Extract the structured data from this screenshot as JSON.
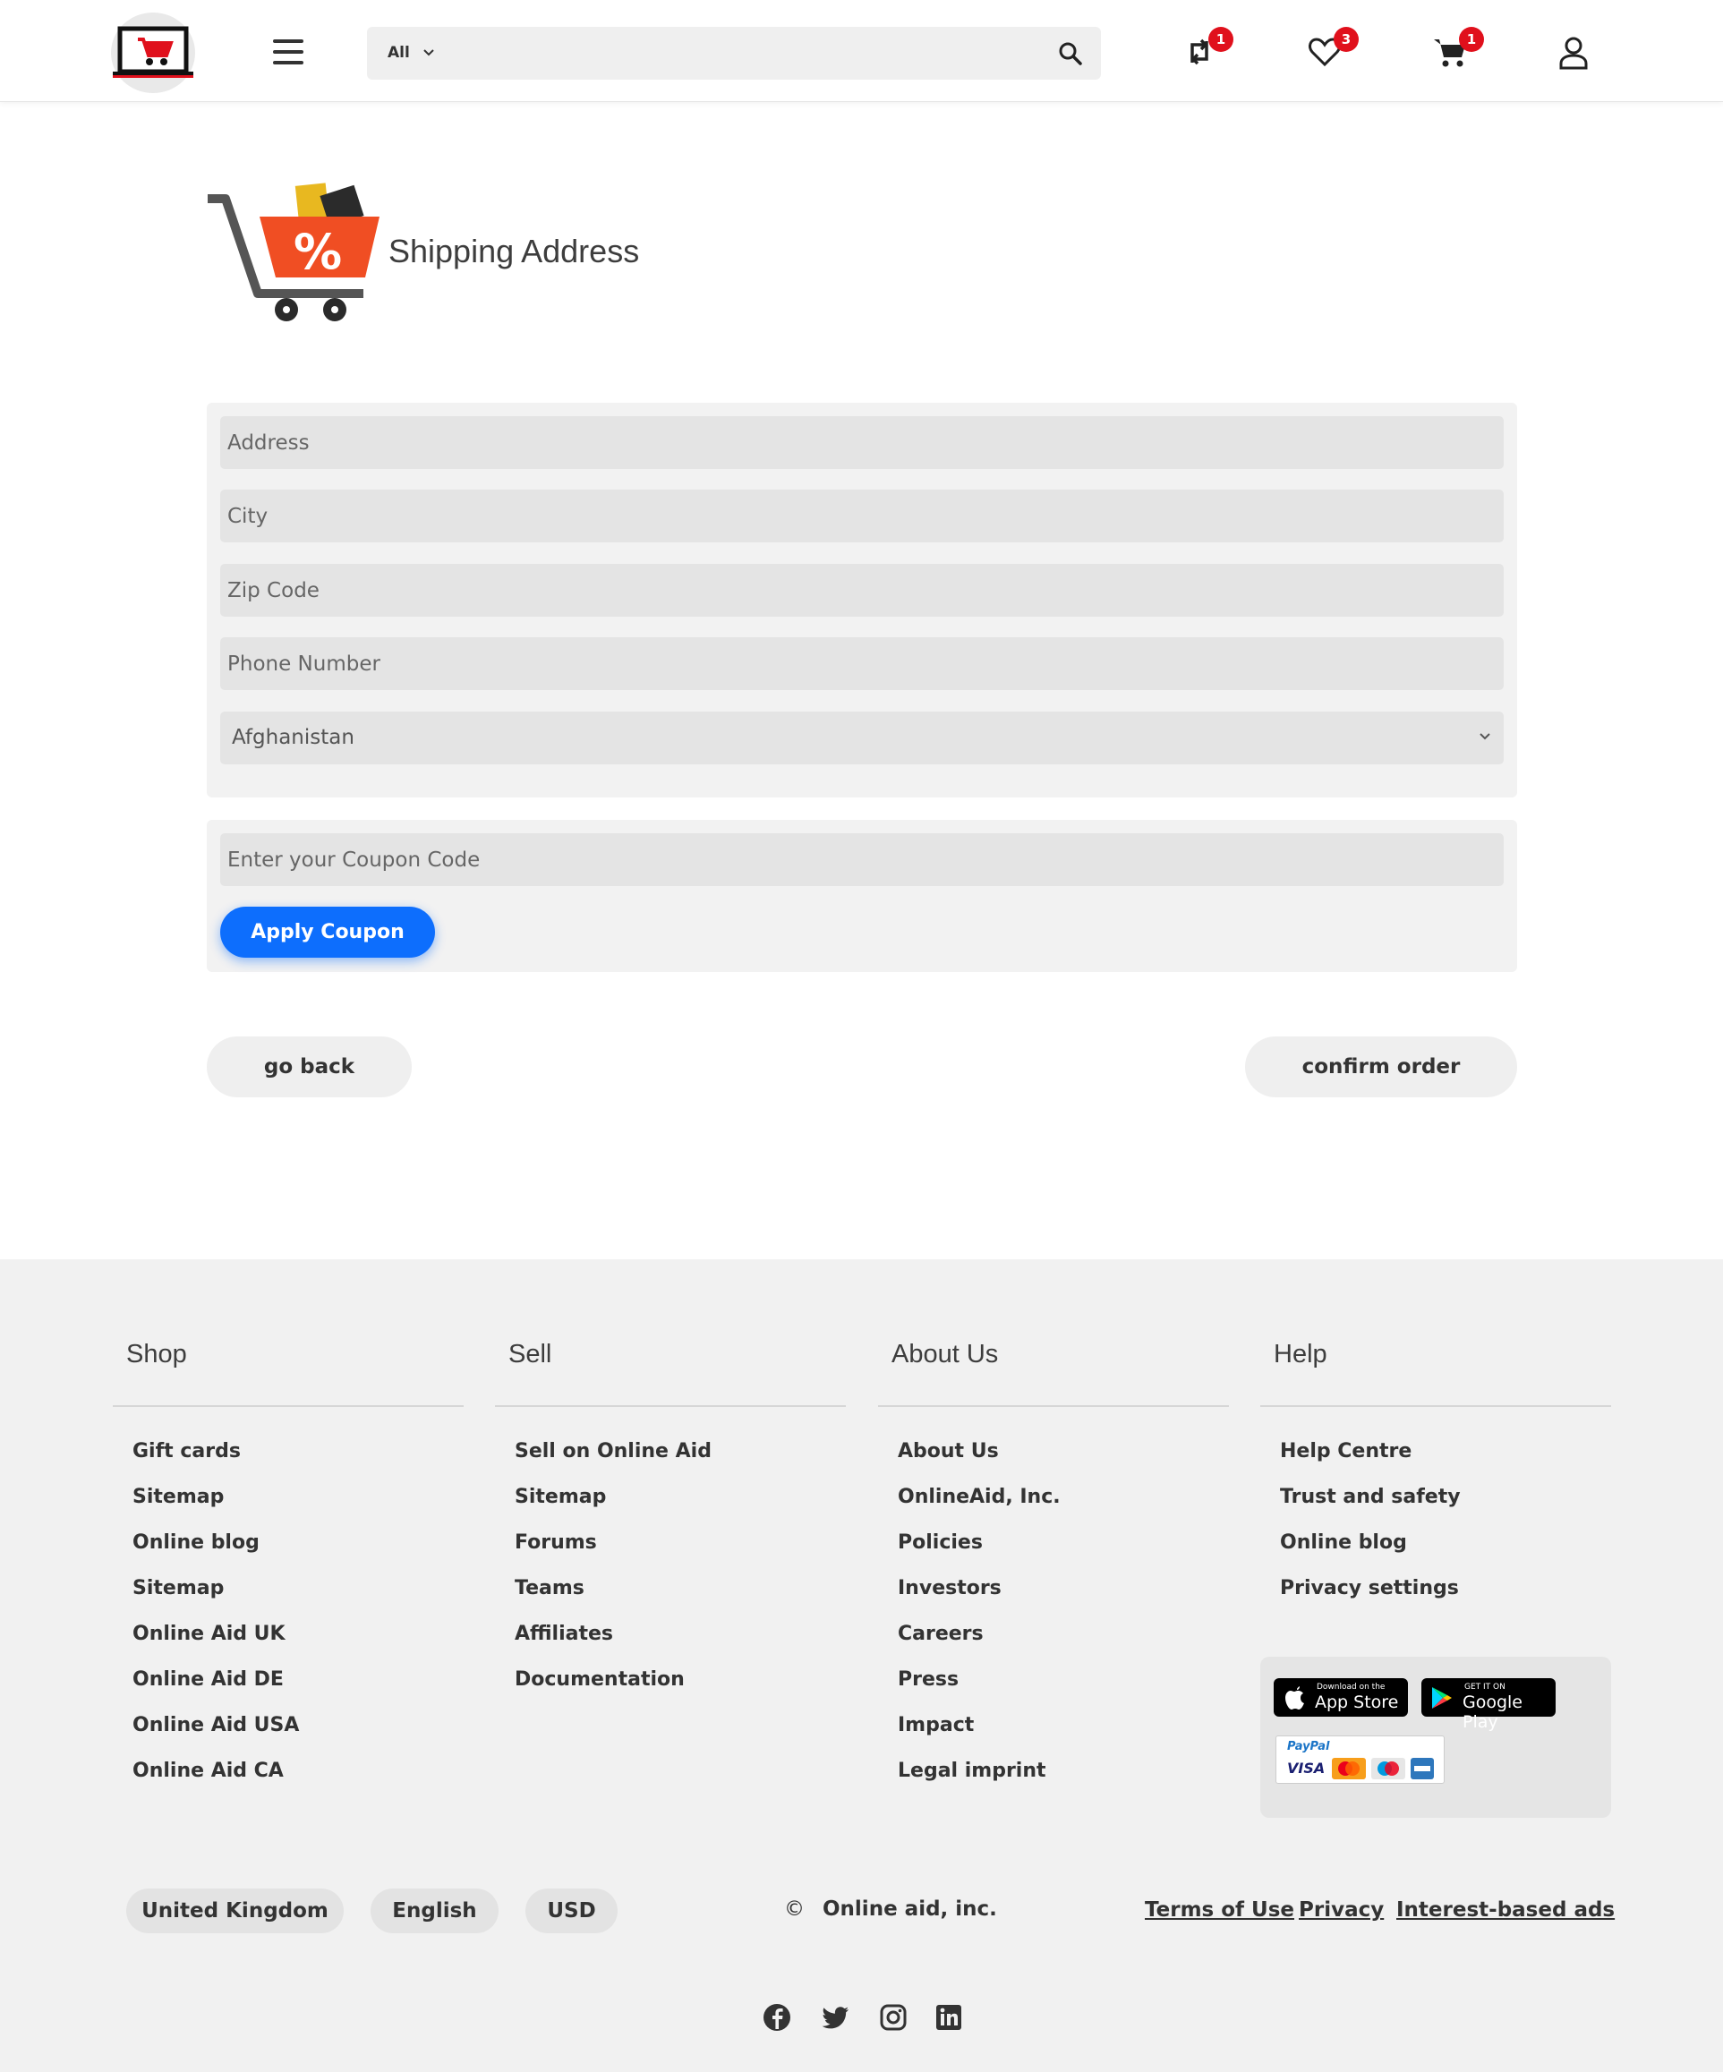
{
  "header": {
    "search_category": "All",
    "search_placeholder": "",
    "compare_count": "1",
    "wishlist_count": "3",
    "cart_count": "1"
  },
  "main": {
    "title": "Shipping Address",
    "address_placeholder": "Address",
    "city_placeholder": "City",
    "zip_placeholder": "Zip Code",
    "phone_placeholder": "Phone Number",
    "country_selected": "Afghanistan",
    "coupon_placeholder": "Enter your Coupon Code",
    "apply_coupon_label": "Apply Coupon",
    "go_back_label": "go back",
    "confirm_order_label": "confirm order"
  },
  "footer": {
    "columns": [
      {
        "title": "Shop",
        "items": [
          "Gift cards",
          "Sitemap",
          "Online blog",
          "Sitemap",
          "Online Aid UK",
          "Online Aid DE",
          "Online Aid USA",
          "Online Aid CA"
        ]
      },
      {
        "title": "Sell",
        "items": [
          "Sell on Online Aid",
          "Sitemap",
          "Forums",
          "Teams",
          "Affiliates",
          "Documentation"
        ]
      },
      {
        "title": "About Us",
        "items": [
          "About Us",
          "OnlineAid, Inc.",
          "Policies",
          "Investors",
          "Careers",
          "Press",
          "Impact",
          "Legal imprint"
        ]
      },
      {
        "title": "Help",
        "items": [
          "Help Centre",
          "Trust and safety",
          "Online blog",
          "Privacy settings"
        ]
      }
    ],
    "app_store_small": "Download on the",
    "app_store_big": "App Store",
    "google_play_small": "GET IT ON",
    "google_play_big": "Google Play",
    "paypal_label": "PayPal",
    "visa_label": "VISA",
    "region": "United Kingdom",
    "language": "English",
    "currency": "USD",
    "copyright_symbol": "©",
    "copyright": "Online aid, inc.",
    "terms": "Terms of Use",
    "privacy": "Privacy",
    "ads": "Interest-based ads",
    "social_icons": [
      "facebook-icon",
      "twitter-icon",
      "instagram-icon",
      "linkedin-icon"
    ]
  },
  "colors": {
    "accent_blue": "#0d6efd",
    "badge_red": "#e0101c",
    "cart_orange": "#f04e23"
  }
}
